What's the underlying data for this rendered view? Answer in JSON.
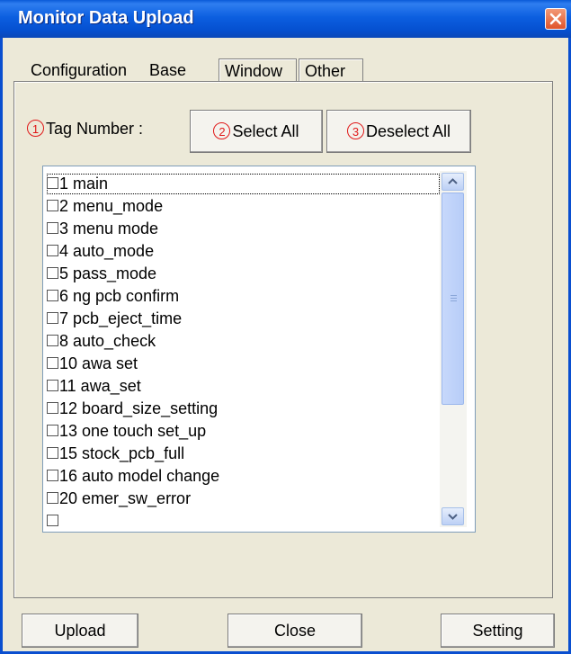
{
  "window": {
    "title": "Monitor Data Upload"
  },
  "tabs": [
    {
      "label": "Configuration"
    },
    {
      "label": "Base"
    },
    {
      "label": "Window"
    },
    {
      "label": "Other"
    }
  ],
  "tag_section": {
    "markers": [
      "1",
      "2",
      "3"
    ],
    "tag_label": "Tag Number :",
    "select_all": "Select All",
    "deselect_all": "Deselect All"
  },
  "tag_list": [
    {
      "label": "1 main",
      "checked": false
    },
    {
      "label": "2 menu_mode",
      "checked": false
    },
    {
      "label": "3 menu mode",
      "checked": false
    },
    {
      "label": "4 auto_mode",
      "checked": false
    },
    {
      "label": "5 pass_mode",
      "checked": false
    },
    {
      "label": "6 ng pcb confirm",
      "checked": false
    },
    {
      "label": "7 pcb_eject_time",
      "checked": false
    },
    {
      "label": "8 auto_check",
      "checked": false
    },
    {
      "label": "10 awa set",
      "checked": false
    },
    {
      "label": "11 awa_set",
      "checked": false
    },
    {
      "label": "12 board_size_setting",
      "checked": false
    },
    {
      "label": "13 one touch set_up",
      "checked": false
    },
    {
      "label": "15 stock_pcb_full",
      "checked": false
    },
    {
      "label": "16 auto model change",
      "checked": false
    },
    {
      "label": "20 emer_sw_error",
      "checked": false
    }
  ],
  "footer": {
    "upload": "Upload",
    "close": "Close",
    "setting": "Setting"
  },
  "icons": {
    "close": "close-icon",
    "scroll_up": "chevron-up-icon",
    "scroll_down": "chevron-down-icon"
  },
  "colors": {
    "titlebar": "#0a5ad8",
    "marker_red": "#e01818",
    "close_button": "#e0542a"
  }
}
